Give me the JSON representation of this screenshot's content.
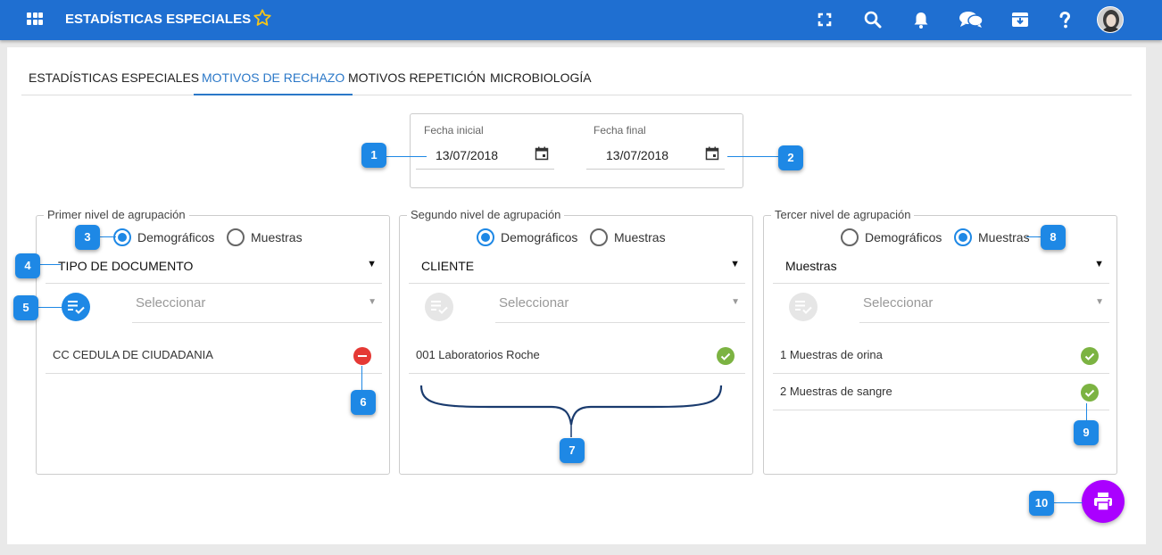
{
  "app": {
    "title": "ESTADÍSTICAS ESPECIALES",
    "brand_color": "#1f6fd1",
    "toolbar_icons": [
      "fullscreen-icon",
      "search-icon",
      "bell-icon",
      "chat-icon",
      "archive-icon",
      "help-icon"
    ]
  },
  "tabs": [
    {
      "label": "ESTADÍSTICAS ESPECIALES",
      "active": false
    },
    {
      "label": "MOTIVOS DE RECHAZO",
      "active": true
    },
    {
      "label": "MOTIVOS REPETICIÓN",
      "active": false
    },
    {
      "label": "MICROBIOLOGÍA",
      "active": false
    }
  ],
  "dates": {
    "start_label": "Fecha inicial",
    "start_value": "13/07/2018",
    "end_label": "Fecha final",
    "end_value": "13/07/2018"
  },
  "groups": [
    {
      "legend": "Primer nivel de agrupación",
      "radio_a": "Demográficos",
      "radio_b": "Muestras",
      "selected": "Demográficos",
      "select_value": "TIPO DE DOCUMENTO",
      "picker_placeholder": "Seleccionar",
      "items": [
        {
          "label": "CC CEDULA DE CIUDADANIA",
          "icon": "remove-icon"
        }
      ]
    },
    {
      "legend": "Segundo nivel de agrupación",
      "radio_a": "Demográficos",
      "radio_b": "Muestras",
      "selected": "Demográficos",
      "select_value": "CLIENTE",
      "picker_placeholder": "Seleccionar",
      "items": [
        {
          "label": "001 Laboratorios Roche",
          "icon": "check-icon"
        }
      ]
    },
    {
      "legend": "Tercer nivel de agrupación",
      "radio_a": "Demográficos",
      "radio_b": "Muestras",
      "selected": "Muestras",
      "select_value": "Muestras",
      "picker_placeholder": "Seleccionar",
      "items": [
        {
          "label": "1 Muestras de orina",
          "icon": "check-icon"
        },
        {
          "label": "2 Muestras de sangre",
          "icon": "check-icon"
        }
      ]
    }
  ],
  "callouts": [
    "1",
    "2",
    "3",
    "4",
    "5",
    "6",
    "7",
    "8",
    "9",
    "10"
  ],
  "colors": {
    "accent": "#1e88e5",
    "remove": "#e53935",
    "check": "#7cb342",
    "print_fab": "#aa00ff"
  }
}
